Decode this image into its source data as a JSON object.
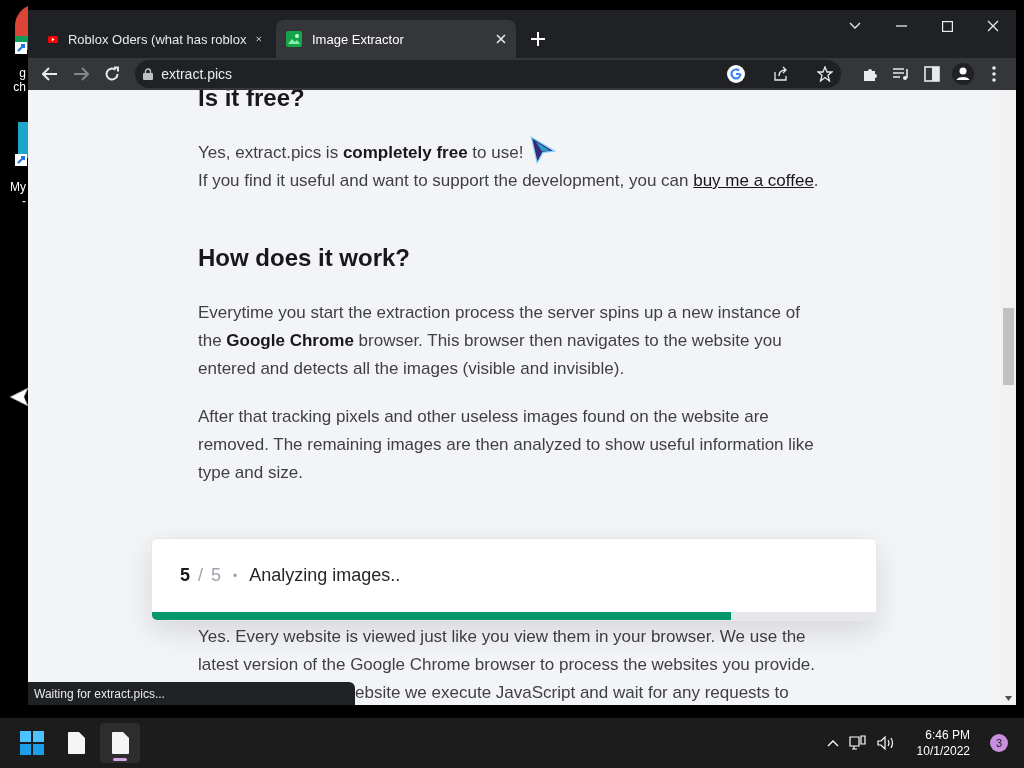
{
  "desktop": {
    "icons": [
      {
        "label_lines": [
          "g",
          "ch"
        ],
        "kind": "browser"
      },
      {
        "label_lines": [
          "My",
          "-"
        ],
        "kind": "app"
      }
    ]
  },
  "browser": {
    "tabs": [
      {
        "title": "Roblox Oders (what has roblox",
        "selected": false,
        "kind": "video"
      },
      {
        "title": "Image Extractor",
        "selected": true,
        "kind": "image"
      }
    ],
    "address": "extract.pics",
    "status": "Waiting for extract.pics..."
  },
  "page": {
    "content": [
      {
        "kind": "heading",
        "text": "Is it free?"
      },
      {
        "kind": "paragraph_lines",
        "lines": [
          {
            "text": "Yes, extract.pics is **completely free** to use!"
          },
          {
            "text": "If you find it useful and want to support the development, you can ",
            "link": "buy me a coffee",
            "after": "."
          }
        ]
      },
      {
        "kind": "heading",
        "text": "How does it work?"
      },
      {
        "kind": "paragraph",
        "text": "Everytime you start the extraction process the server spins up a new instance of the **Google Chrome** browser. This browser then navigates to the website you entered and detects all the images (visible and invisible)."
      },
      {
        "kind": "paragraph",
        "text": "After that tracking pixels and other useless images found on the website are removed. The remaining images are then analyzed to show useful information like type and size."
      },
      {
        "kind": "covered_paragraph",
        "text": "Yes. Every website is viewed just like you view them in your browser. We use the latest version of the Google Chrome browser to process the websites you provide."
      },
      {
        "kind": "tail_line",
        "text": "ebsite we execute JavaScript and wait for any requests to"
      }
    ],
    "progress": {
      "step": "5",
      "separator": "/",
      "total": "5",
      "bullet": "•",
      "message": "Analyzing images..",
      "level": 0.8
    }
  },
  "taskbar": {
    "apps": [
      {
        "selected": false
      },
      {
        "selected": true
      }
    ],
    "time": "6:46 PM",
    "date": "10/1/2022",
    "notifications": "3"
  }
}
